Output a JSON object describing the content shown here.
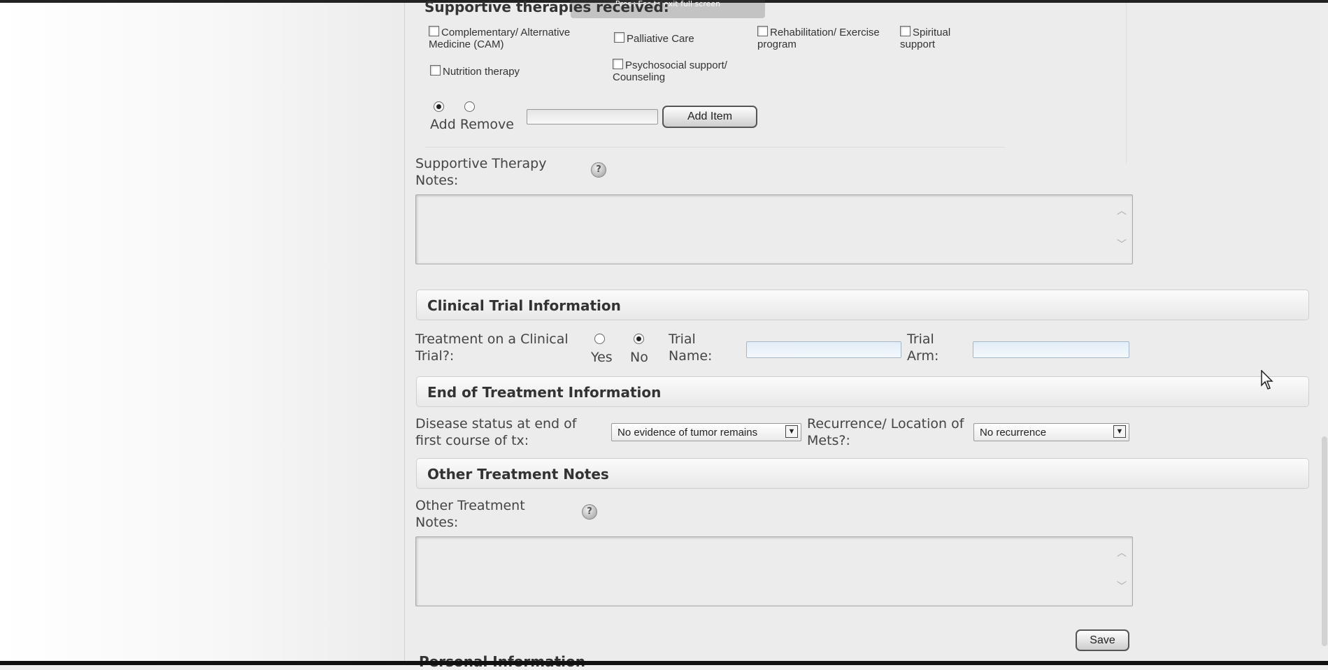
{
  "fullscreen_hint": "Press  Esc  to exit full screen",
  "supportive_therapies": {
    "title": "Supportive therapies received:",
    "options": [
      {
        "label": "Complementary/ Alternative Medicine (CAM)",
        "checked": false
      },
      {
        "label": "Palliative Care",
        "checked": false
      },
      {
        "label": "Rehabilitation/ Exercise program",
        "checked": false
      },
      {
        "label": "Spiritual support",
        "checked": false
      },
      {
        "label": "Nutrition therapy",
        "checked": false
      },
      {
        "label": "Psychosocial support/ Counseling",
        "checked": false
      }
    ],
    "mode_add_label": "Add",
    "mode_remove_label": "Remove",
    "mode_selected": "Add",
    "new_item_value": "",
    "add_item_button": "Add Item"
  },
  "supportive_notes": {
    "label": "Supportive Therapy Notes:",
    "help": "?",
    "value": ""
  },
  "clinical_trial": {
    "header": "Clinical Trial Information",
    "question_label": "Treatment on a Clinical Trial?:",
    "yes_label": "Yes",
    "no_label": "No",
    "selected": "No",
    "trial_name_label": "Trial Name:",
    "trial_name_value": "",
    "trial_arm_label": "Trial Arm:",
    "trial_arm_value": ""
  },
  "end_of_treatment": {
    "header": "End of Treatment Information",
    "disease_status_label": "Disease status at end of first course of tx:",
    "disease_status_value": "No evidence of tumor remains",
    "recurrence_label": "Recurrence/ Location of Mets?:",
    "recurrence_value": "No recurrence"
  },
  "other_treatment": {
    "header": "Other Treatment Notes",
    "notes_label": "Other Treatment Notes:",
    "help": "?",
    "value": ""
  },
  "save_button": "Save",
  "next_section_partial": "Personal Information"
}
